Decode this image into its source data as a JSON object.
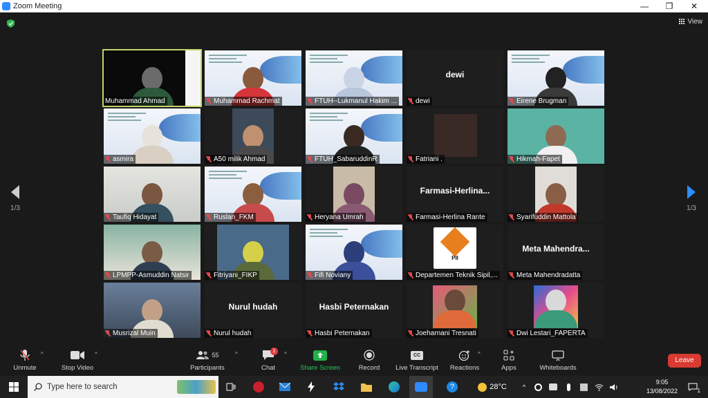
{
  "window": {
    "title": "Zoom Meeting",
    "minimize": "—",
    "maximize": "❐",
    "close": "✕"
  },
  "meeting": {
    "view_label": "View",
    "page_left": "1/3",
    "page_right": "1/3",
    "tiles": [
      {
        "name": "Muhammad Ahmad",
        "type": "person-black",
        "active": true
      },
      {
        "name": "Muhammad Rachmat",
        "type": "slide-person",
        "head": "#8a5a3c",
        "body": "#d6363a"
      },
      {
        "name": "FTUH--Lukmanul Hakim ...",
        "type": "slide"
      },
      {
        "name": "dewi",
        "type": "text",
        "big": "dewi"
      },
      {
        "name": "Eirene Brugman",
        "type": "slide-person",
        "head": "#222",
        "body": "#3a3a3a"
      },
      {
        "name": "asmira",
        "type": "slide-person",
        "head": "#e7e2da",
        "body": "#d9cfc2"
      },
      {
        "name": "A50 milik Ahmad",
        "type": "thumb-person"
      },
      {
        "name": "FTUH_SabaruddinR",
        "type": "slide-person",
        "head": "#3b2a22",
        "body": "#222"
      },
      {
        "name": "Fatriani .",
        "type": "thumb-dark"
      },
      {
        "name": "Hikmah-Fapet",
        "type": "green-person"
      },
      {
        "name": "Taufiq Hidayat",
        "type": "room-person"
      },
      {
        "name": "Ruslan_FKM",
        "type": "slide-person",
        "head": "#8b5e3f",
        "body": "#c74b4b"
      },
      {
        "name": "Heryana Umrah",
        "type": "thumb-hijab"
      },
      {
        "name": "Farmasi-Herlina Rante",
        "type": "text",
        "big": "Farmasi-Herlina..."
      },
      {
        "name": "Syarifuddin Mattola",
        "type": "thumb-red"
      },
      {
        "name": "LPMPP-Asmuddin Natsir",
        "type": "room-person2"
      },
      {
        "name": "Fitriyani_FIKP",
        "type": "thumb-hijab2"
      },
      {
        "name": "Fifi Noviany",
        "type": "slide-person",
        "head": "#2d3f7a",
        "body": "#3b4f9a"
      },
      {
        "name": "Departemen Teknik Sipil,...",
        "type": "logo",
        "logo_text": "PII"
      },
      {
        "name": "Meta Mahendradatta",
        "type": "text",
        "big": "Meta  Mahendra..."
      },
      {
        "name": "Musrizal Muin",
        "type": "room-person3"
      },
      {
        "name": "Nurul hudah",
        "type": "text",
        "big": "Nurul hudah"
      },
      {
        "name": "Hasbi Peternakan",
        "type": "text",
        "big": "Hasbi Peternakan"
      },
      {
        "name": "Joeharnani Tresnati",
        "type": "thumb-flower"
      },
      {
        "name": "Dwi Lestari_FAPERTA",
        "type": "thumb-colorful"
      }
    ]
  },
  "toolbar": {
    "unmute": "Unmute",
    "stop_video": "Stop Video",
    "participants": "Participants",
    "participants_count": "55",
    "chat": "Chat",
    "chat_badge": "1",
    "share": "Share Screen",
    "record": "Record",
    "transcript": "Live Transcript",
    "transcript_icon": "CC",
    "reactions": "Reactions",
    "apps": "Apps",
    "whiteboards": "Whiteboards",
    "leave": "Leave",
    "share_color": "#23b04b",
    "leave_color": "#d93a31"
  },
  "taskbar": {
    "search_placeholder": "Type here to search",
    "weather": "28°C",
    "time": "9:05",
    "date": "13/08/2022",
    "notification_count": "1"
  }
}
